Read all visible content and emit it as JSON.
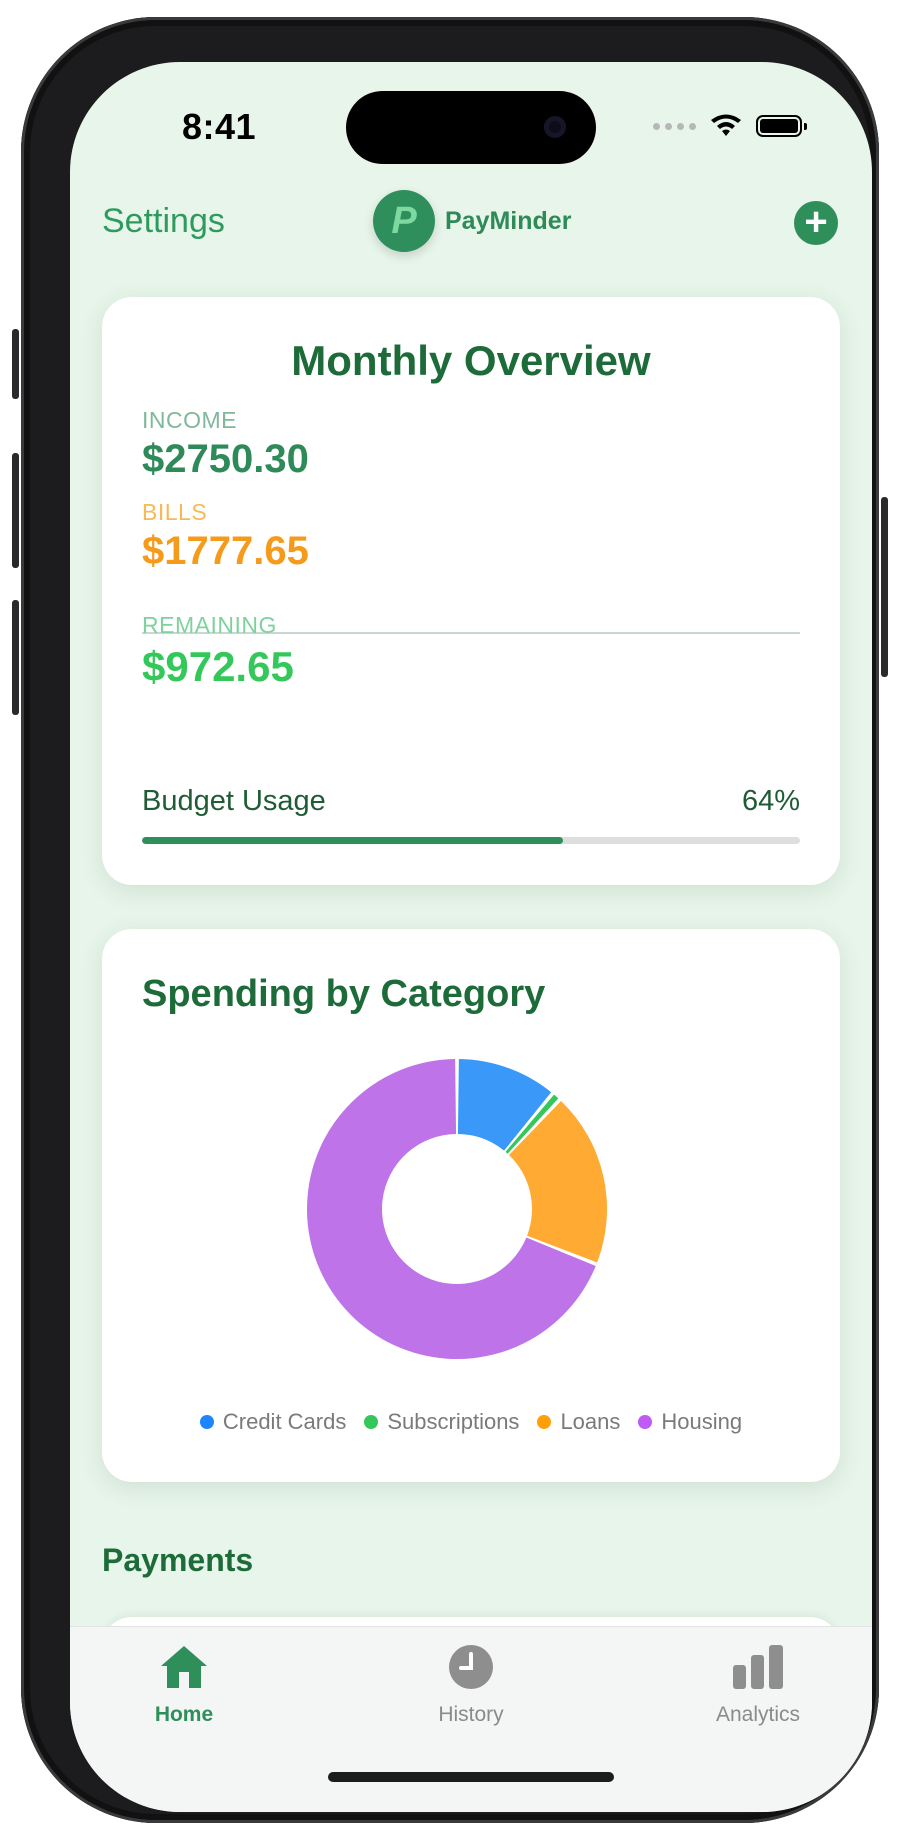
{
  "status_bar": {
    "time": "8:41"
  },
  "header": {
    "settings_label": "Settings",
    "logo_letter": "P",
    "app_name": "PayMinder",
    "add_icon": "plus-circle-icon"
  },
  "overview": {
    "title": "Monthly Overview",
    "income_label": "INCOME",
    "income_value": "$2750.30",
    "bills_label": "BILLS",
    "bills_value": "$1777.65",
    "remaining_label": "REMAINING",
    "remaining_value": "$972.65",
    "budget_label": "Budget Usage",
    "budget_pct_text": "64%",
    "budget_fraction": 0.64,
    "colors": {
      "income": "#2e9a5e",
      "bills": "#f7a325",
      "remaining": "#34c759",
      "title": "#1e6b3a"
    }
  },
  "spending": {
    "title": "Spending by Category",
    "legend": [
      {
        "label": "Credit Cards",
        "color": "#1e84ff"
      },
      {
        "label": "Subscriptions",
        "color": "#34c759"
      },
      {
        "label": "Loans",
        "color": "#ff9f0a"
      },
      {
        "label": "Housing",
        "color": "#bf5af2"
      }
    ]
  },
  "chart_data": {
    "type": "pie",
    "categories": [
      "Credit Cards",
      "Subscriptions",
      "Loans",
      "Housing"
    ],
    "values": [
      11,
      1,
      19,
      69
    ],
    "colors": [
      "#3a99f8",
      "#34c759",
      "#ffaa33",
      "#bf73e8"
    ],
    "legend_position": "bottom",
    "donut": true
  },
  "payments": {
    "title": "Payments"
  },
  "tabbar": {
    "items": [
      {
        "label": "Home",
        "icon": "house-icon",
        "active": true
      },
      {
        "label": "History",
        "icon": "clock-icon",
        "active": false
      },
      {
        "label": "Analytics",
        "icon": "bar-chart-icon",
        "active": false
      }
    ]
  }
}
